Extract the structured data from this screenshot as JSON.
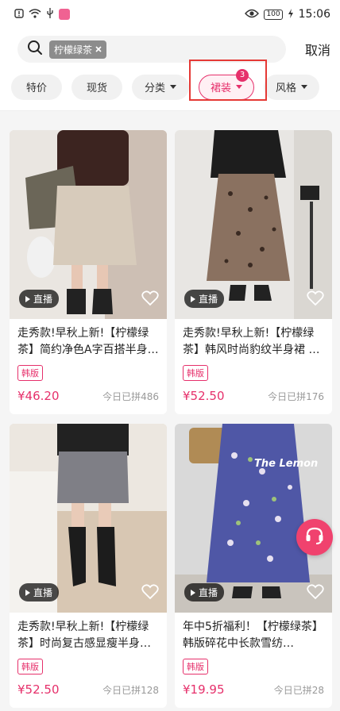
{
  "status_bar": {
    "time": "15:06",
    "battery": "100"
  },
  "search": {
    "chip_text": "柠檬绿茶",
    "cancel_label": "取消"
  },
  "filters": [
    {
      "label": "特价",
      "has_arrow": false
    },
    {
      "label": "现货",
      "has_arrow": false
    },
    {
      "label": "分类",
      "has_arrow": true
    },
    {
      "label": "裙装",
      "has_arrow": true,
      "active": true,
      "badge": "3"
    },
    {
      "label": "风格",
      "has_arrow": true
    }
  ],
  "products": [
    {
      "title": "走秀款!早秋上新!【柠檬绿茶】简约净色A字百搭半身…",
      "tag": "韩版",
      "price": "¥46.20",
      "sold": "今日已拼486",
      "live_label": "直播"
    },
    {
      "title": "走秀款!早秋上新!【柠檬绿茶】韩风时尚豹纹半身裙 …",
      "tag": "韩版",
      "price": "¥52.50",
      "sold": "今日已拼176",
      "live_label": "直播"
    },
    {
      "title": "走秀款!早秋上新!【柠檬绿茶】时尚复古感显瘦半身…",
      "tag": "韩版",
      "price": "¥52.50",
      "sold": "今日已拼128",
      "live_label": "直播"
    },
    {
      "title": "年中5折福利！【柠檬绿茶】韩版碎花中长款雪纺…",
      "tag": "韩版",
      "price": "¥19.95",
      "sold": "今日已拼28",
      "live_label": "直播"
    }
  ],
  "photo_watermarks": [
    "The Lemon"
  ],
  "colors": {
    "accent": "#e6306b",
    "service_button": "#f0426e"
  }
}
